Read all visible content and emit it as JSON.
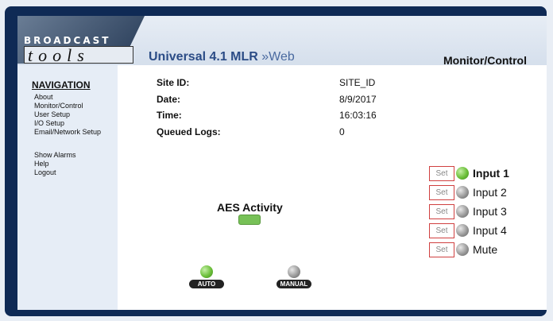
{
  "header": {
    "logo_top": "BROADCAST",
    "logo_bottom": "tools",
    "app_title": "Universal 4.1 MLR",
    "app_title_suffix": "»Web",
    "page_title": "Monitor/Control"
  },
  "sidebar": {
    "heading": "NAVIGATION",
    "items": [
      "About",
      "Monitor/Control",
      "User Setup",
      "I/O Setup",
      "Email/Network Setup"
    ],
    "extra_items": [
      "Show Alarms",
      "Help",
      "Logout"
    ]
  },
  "status": {
    "site_id_label": "Site ID:",
    "site_id_value": "SITE_ID",
    "date_label": "Date:",
    "date_value": "8/9/2017",
    "time_label": "Time:",
    "time_value": "16:03:16",
    "queued_label": "Queued Logs:",
    "queued_value": "0"
  },
  "aes": {
    "label": "AES Activity",
    "active": true
  },
  "modes": [
    {
      "label": "AUTO",
      "active": true
    },
    {
      "label": "MANUAL",
      "active": false
    }
  ],
  "inputs": [
    {
      "set_label": "Set",
      "label": "Input 1",
      "active": true
    },
    {
      "set_label": "Set",
      "label": "Input 2",
      "active": false
    },
    {
      "set_label": "Set",
      "label": "Input 3",
      "active": false
    },
    {
      "set_label": "Set",
      "label": "Input 4",
      "active": false
    },
    {
      "set_label": "Set",
      "label": "Mute",
      "active": false
    }
  ],
  "colors": {
    "frame": "#0f2a55",
    "sidebar": "#e6edf6",
    "led_on": "#6cbf3a",
    "led_off": "#9a9a9a",
    "set_border": "#d04040",
    "title_blue": "#2b4c86"
  }
}
